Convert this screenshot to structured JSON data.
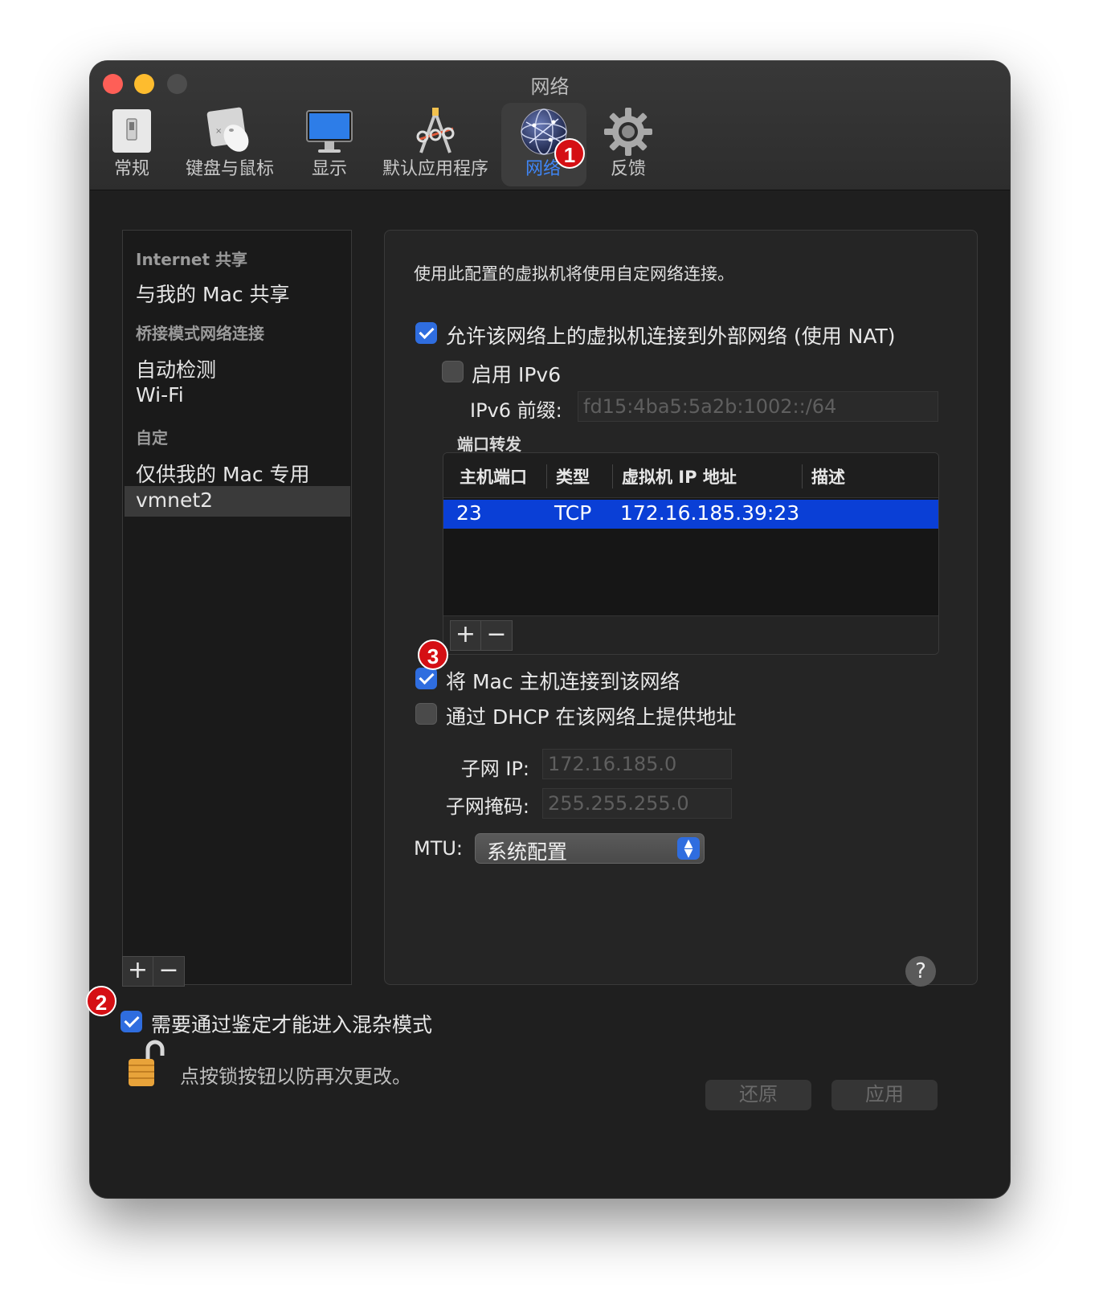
{
  "window": {
    "title": "网络"
  },
  "toolbar": {
    "items": [
      {
        "label": "常规",
        "icon": "switch-icon"
      },
      {
        "label": "键盘与鼠标",
        "icon": "keyboard-mouse-icon"
      },
      {
        "label": "显示",
        "icon": "monitor-icon"
      },
      {
        "label": "默认应用程序",
        "icon": "app-tools-icon"
      },
      {
        "label": "网络",
        "icon": "globe-icon",
        "selected": true
      },
      {
        "label": "反馈",
        "icon": "gear-icon"
      }
    ]
  },
  "badges": {
    "one": "1",
    "two": "2",
    "three": "3"
  },
  "sidebar": {
    "section_internet": "Internet 共享",
    "item_share_with_mac": "与我的 Mac 共享",
    "section_bridged": "桥接模式网络连接",
    "item_autodetect": "自动检测",
    "item_wifi": "Wi-Fi",
    "section_custom": "自定",
    "item_private_mac": "仅供我的 Mac 专用",
    "item_vmnet2": "vmnet2",
    "add_label": "+",
    "remove_label": "−"
  },
  "panel": {
    "description": "使用此配置的虚拟机将使用自定网络连接。",
    "nat_label": "允许该网络上的虚拟机连接到外部网络 (使用 NAT)",
    "nat_checked": true,
    "ipv6_label": "启用 IPv6",
    "ipv6_checked": false,
    "ipv6_prefix_label": "IPv6 前缀:",
    "ipv6_prefix_value": "fd15:4ba5:5a2b:1002::/64",
    "port_forward_label": "端口转发",
    "table": {
      "headers": [
        "主机端口",
        "类型",
        "虚拟机 IP 地址",
        "描述"
      ],
      "rows": [
        {
          "host_port": "23",
          "type": "TCP",
          "vm_ip": "172.16.185.39:23",
          "desc": ""
        }
      ],
      "add_label": "+",
      "remove_label": "−"
    },
    "connect_host_label": "将 Mac 主机连接到该网络",
    "connect_host_checked": true,
    "dhcp_label": "通过 DHCP 在该网络上提供地址",
    "dhcp_checked": false,
    "subnet_ip_label": "子网 IP:",
    "subnet_ip_value": "172.16.185.0",
    "subnet_mask_label": "子网掩码:",
    "subnet_mask_value": "255.255.255.0",
    "mtu_label": "MTU:",
    "mtu_value": "系统配置"
  },
  "footer": {
    "promiscuous_label": "需要通过鉴定才能进入混杂模式",
    "promiscuous_checked": true,
    "lock_text": "点按锁按钮以防再次更改。",
    "help_label": "?",
    "revert_label": "还原",
    "apply_label": "应用"
  },
  "colors": {
    "accent": "#2f6ddf",
    "selected_row": "#0a3fd6",
    "badge": "#d50f14",
    "selected_tab_label": "#3f86f7"
  }
}
